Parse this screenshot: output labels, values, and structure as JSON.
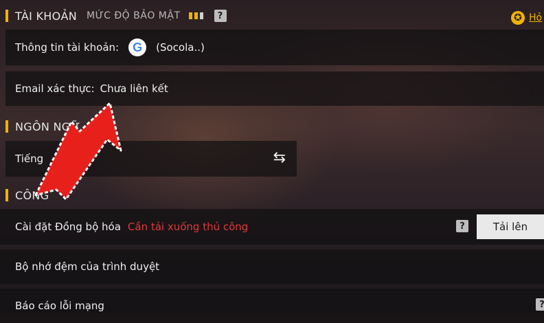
{
  "sections": {
    "account": {
      "title": "TÀI KHOẢN",
      "subtitle": "MỨC ĐỘ BẢO MẬT",
      "security_level": 2,
      "security_max": 3
    },
    "language": {
      "title": "NGÔN NGỮ"
    },
    "tools": {
      "title": "CÔNG"
    }
  },
  "helper": {
    "label": "Hỏ"
  },
  "account_info": {
    "label": "Thông tin tài khoản:",
    "provider_icon": "google-icon",
    "name": "(Socola..)"
  },
  "email": {
    "label": "Email xác thực:",
    "value": "Chưa liên kết"
  },
  "language_row": {
    "label": "Tiếng",
    "swap_icon": "⇆"
  },
  "sync": {
    "label": "Cài đặt Đồng bộ hóa",
    "warning": "Cần tải xuống thủ công",
    "upload_label": "Tải lên"
  },
  "cache": {
    "label": "Bộ nhớ đệm của trình duyệt"
  },
  "network": {
    "label": "Báo cáo lỗi mạng"
  },
  "colors": {
    "accent": "#f0b400",
    "warning": "#e03a3a",
    "arrow": "#e8201c"
  }
}
